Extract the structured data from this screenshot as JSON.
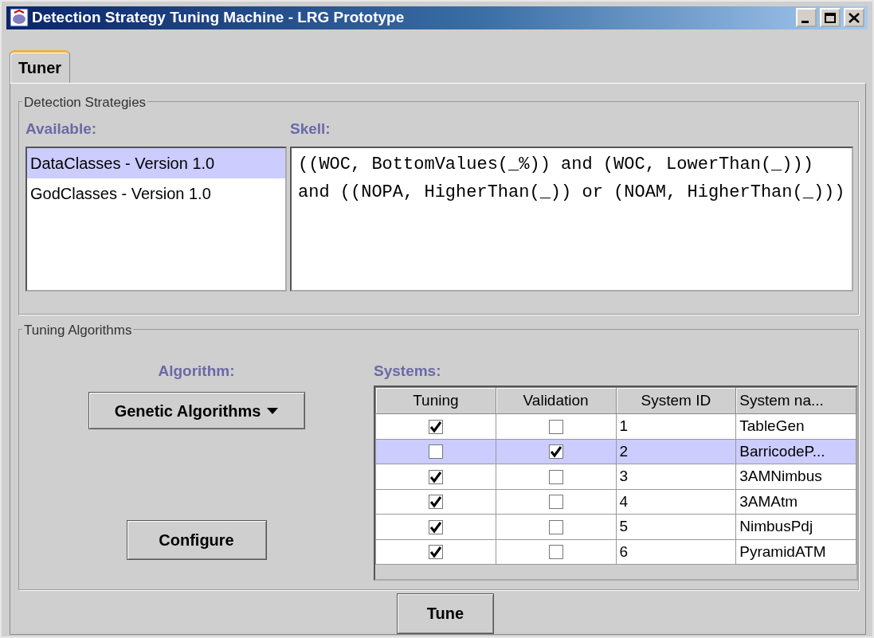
{
  "window": {
    "title": "Detection Strategy Tuning Machine - LRG Prototype"
  },
  "tabs": [
    {
      "label": "Tuner",
      "selected": true
    }
  ],
  "detection_strategies": {
    "title": "Detection Strategies",
    "available_label": "Available:",
    "skell_label": "Skell:",
    "available": [
      {
        "label": "DataClasses - Version 1.0",
        "selected": true
      },
      {
        "label": "GodClasses - Version 1.0",
        "selected": false
      }
    ],
    "skell_text": "((WOC, BottomValues(_%)) and (WOC, LowerThan(_))) and ((NOPA, HigherThan(_)) or (NOAM, HigherThan(_)))"
  },
  "tuning_algorithms": {
    "title": "Tuning Algorithms",
    "algorithm_label": "Algorithm:",
    "algorithm_value": "Genetic Algorithms",
    "configure_button": "Configure",
    "systems_label": "Systems:",
    "columns": [
      "Tuning",
      "Validation",
      "System ID",
      "System na..."
    ],
    "rows": [
      {
        "tuning": true,
        "validation": false,
        "system_id": "1",
        "system_name": "TableGen",
        "selected": false
      },
      {
        "tuning": false,
        "validation": true,
        "system_id": "2",
        "system_name": "BarricodeP...",
        "selected": true
      },
      {
        "tuning": true,
        "validation": false,
        "system_id": "3",
        "system_name": "3AMNimbus",
        "selected": false
      },
      {
        "tuning": true,
        "validation": false,
        "system_id": "4",
        "system_name": "3AMAtm",
        "selected": false
      },
      {
        "tuning": true,
        "validation": false,
        "system_id": "5",
        "system_name": "NimbusPdj",
        "selected": false
      },
      {
        "tuning": true,
        "validation": false,
        "system_id": "6",
        "system_name": "PyramidATM",
        "selected": false
      }
    ]
  },
  "tune_button": "Tune"
}
